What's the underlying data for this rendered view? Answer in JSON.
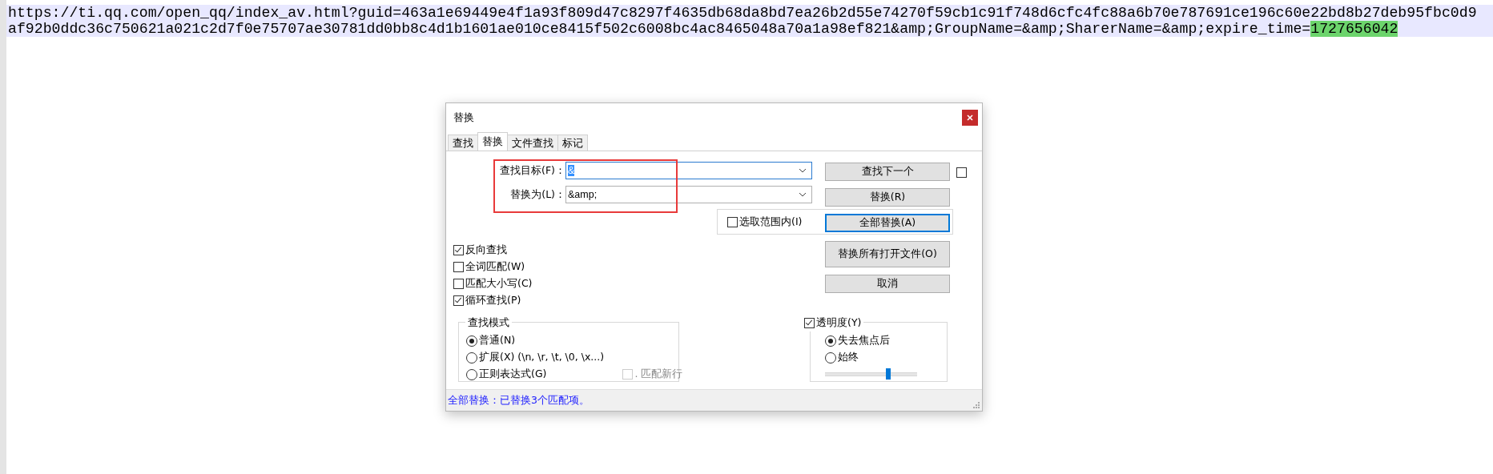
{
  "editor": {
    "lines": [
      {
        "segments": [
          {
            "text": "https://ti.qq.com/open_qq/index_av.html?guid=463a1e69449e4f1a93f809d47c8297f4635db68da8bd7ea26b2d55e74270f59cb1c91f748d6cfc4fc88a6b70e787691ce196c60e22bd8b27deb95fbc0d9",
            "marked": false
          }
        ]
      },
      {
        "segments": [
          {
            "text": "af92b0ddc36c750621a021c2d7f0e75707ae30781dd0bb8c4d1b1601ae010ce8415f502c6008bc4ac8465048a70a1a98ef821&amp;GroupName=&amp;SharerName=&amp;expire_time=",
            "marked": false
          },
          {
            "text": "1727656042",
            "marked": true
          }
        ]
      }
    ]
  },
  "dialog": {
    "title": "替换",
    "tabs": [
      {
        "label": "查找",
        "selected": false
      },
      {
        "label": "替换",
        "selected": true
      },
      {
        "label": "文件查找",
        "selected": false
      },
      {
        "label": "标记",
        "selected": false
      }
    ],
    "fields": [
      {
        "label": "查找目标(F)：",
        "value": "&",
        "value_selected": true
      },
      {
        "label": "替换为(L)：",
        "value": "&amp;",
        "value_selected": false
      }
    ],
    "annotation": {
      "kind": "frame"
    },
    "buttons": [
      {
        "label": "查找下一个",
        "focused": false
      },
      {
        "label": "替换(R)",
        "focused": false
      },
      {
        "label": "全部替换(A)",
        "focused": true
      },
      {
        "label": "替换所有打开文件(O)",
        "focused": false
      },
      {
        "label": "取消",
        "focused": false
      }
    ],
    "side_checkbox": {
      "checked": false
    },
    "in_selection": {
      "label": "选取范围内(I)",
      "checked": false
    },
    "options": [
      {
        "label": "反向查找",
        "checked": true
      },
      {
        "label": "全词匹配(W)",
        "checked": false
      },
      {
        "label": "匹配大小写(C)",
        "checked": false
      },
      {
        "label": "循环查找(P)",
        "checked": true
      }
    ],
    "search_mode": {
      "title": "查找模式",
      "options": [
        {
          "label": "普通(N)",
          "selected": true
        },
        {
          "label": "扩展(X) (\\n, \\r, \\t, \\0, \\x...)",
          "selected": false
        },
        {
          "label": "正则表达式(G)",
          "selected": false
        }
      ],
      "dot_newline": {
        "label": ". 匹配新行",
        "checked": false,
        "disabled": true
      }
    },
    "transparency": {
      "label": "透明度(Y)",
      "checked": true,
      "options": [
        {
          "label": "失去焦点后",
          "selected": true
        },
        {
          "label": "始终",
          "selected": false
        }
      ],
      "level": 0.69
    },
    "status": "全部替换：已替换3个匹配项。"
  }
}
